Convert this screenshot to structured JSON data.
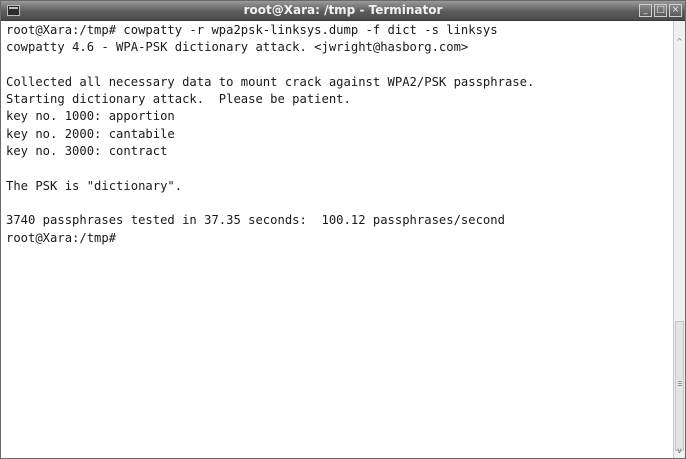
{
  "window": {
    "title": "root@Xara: /tmp - Terminator",
    "minimize_glyph": "_",
    "maximize_glyph": "□",
    "close_glyph": "×"
  },
  "terminal": {
    "lines": [
      "root@Xara:/tmp# cowpatty -r wpa2psk-linksys.dump -f dict -s linksys",
      "cowpatty 4.6 - WPA-PSK dictionary attack. <jwright@hasborg.com>",
      "",
      "Collected all necessary data to mount crack against WPA2/PSK passphrase.",
      "Starting dictionary attack.  Please be patient.",
      "key no. 1000: apportion",
      "key no. 2000: cantabile",
      "key no. 3000: contract",
      "",
      "The PSK is \"dictionary\".",
      "",
      "3740 passphrases tested in 37.35 seconds:  100.12 passphrases/second",
      "root@Xara:/tmp#"
    ]
  },
  "scrollbar": {
    "up_glyph": "^",
    "down_glyph": "v",
    "grip_icon": "scroll-grip-icon"
  }
}
